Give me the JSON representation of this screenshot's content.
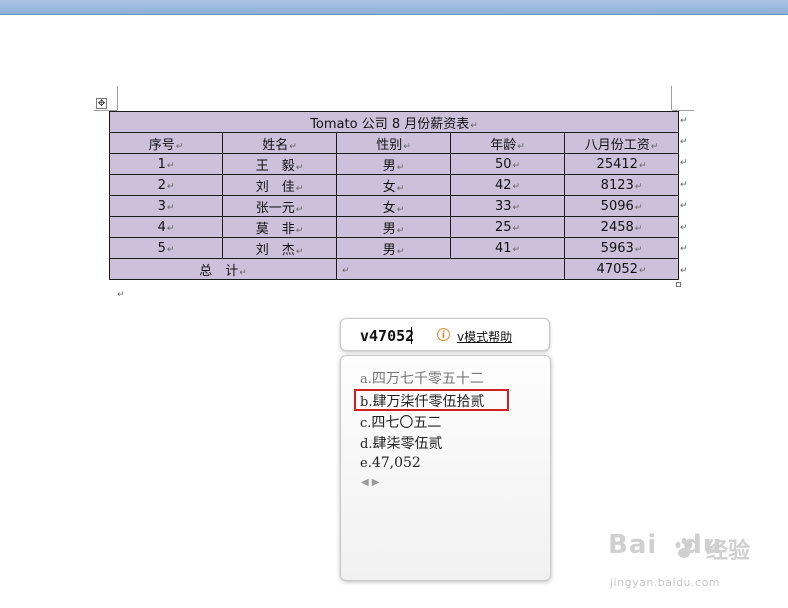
{
  "table": {
    "title": "Tomato 公司 8 月份薪资表",
    "headers": [
      "序号",
      "姓名",
      "性别",
      "年龄",
      "八月份工资"
    ],
    "rows": [
      [
        "1",
        "王　毅",
        "男",
        "50",
        "25412"
      ],
      [
        "2",
        "刘　佳",
        "女",
        "42",
        "8123"
      ],
      [
        "3",
        "张一元",
        "女",
        "33",
        "5096"
      ],
      [
        "4",
        "莫　非",
        "男",
        "25",
        "2458"
      ],
      [
        "5",
        "刘　杰",
        "男",
        "41",
        "5963"
      ]
    ],
    "total_label": "总　计",
    "total_value": "47052",
    "mark": "↵",
    "move_handle": "✥"
  },
  "ime": {
    "code": "v47052",
    "info_icon": "i",
    "help_link": "v模式帮助",
    "candidates": [
      {
        "prefix": "a.",
        "text": "四万七千零五十二"
      },
      {
        "prefix": "b.",
        "text": "肆万柒仟零伍拾贰"
      },
      {
        "prefix": "c.",
        "text": "四七〇五二"
      },
      {
        "prefix": "d.",
        "text": "肆柒零伍贰"
      },
      {
        "prefix": "e.",
        "text": "47,052"
      }
    ],
    "pager_prev": "◀",
    "pager_next": "▶",
    "highlight_color": "#d02020"
  },
  "watermark": {
    "brand": "Bai",
    "brand_tail": "du",
    "product": "经验",
    "url": "jingyan.baidu.com"
  }
}
